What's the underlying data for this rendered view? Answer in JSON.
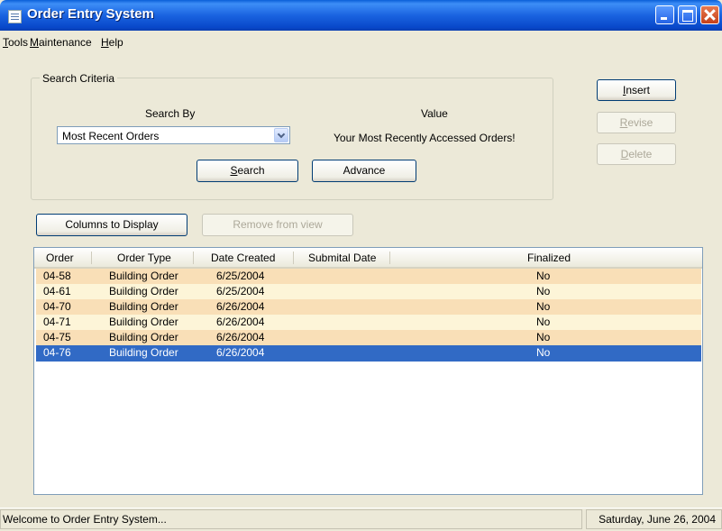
{
  "window": {
    "title": "Order Entry System"
  },
  "menu": {
    "items": [
      {
        "hotkey": "T",
        "rest": "ools"
      },
      {
        "hotkey": "M",
        "rest": "aintenance"
      },
      {
        "hotkey": "H",
        "rest": "elp"
      }
    ]
  },
  "search": {
    "group_label": "Search Criteria",
    "search_by_label": "Search By",
    "search_by_value": "Most Recent Orders",
    "value_label": "Value",
    "value_text": "Your Most Recently Accessed Orders!",
    "search_button": {
      "hotkey": "S",
      "rest": "earch"
    },
    "advance_button": "Advance"
  },
  "actions": {
    "insert": {
      "hotkey": "I",
      "rest": "nsert"
    },
    "revise": {
      "hotkey": "R",
      "rest": "evise"
    },
    "delete": {
      "hotkey": "D",
      "rest": "elete"
    }
  },
  "list_controls": {
    "columns_to_display": "Columns to Display",
    "remove_from_view": "Remove from view"
  },
  "table": {
    "columns": [
      "Order",
      "Order Type",
      "Date Created",
      "Submital Date",
      "Finalized"
    ],
    "rows": [
      {
        "order": "04-58",
        "order_type": "Building Order",
        "date_created": "6/25/2004",
        "submital_date": "",
        "finalized": "No"
      },
      {
        "order": "04-61",
        "order_type": "Building Order",
        "date_created": "6/25/2004",
        "submital_date": "",
        "finalized": "No"
      },
      {
        "order": "04-70",
        "order_type": "Building Order",
        "date_created": "6/26/2004",
        "submital_date": "",
        "finalized": "No"
      },
      {
        "order": "04-71",
        "order_type": "Building Order",
        "date_created": "6/26/2004",
        "submital_date": "",
        "finalized": "No"
      },
      {
        "order": "04-75",
        "order_type": "Building Order",
        "date_created": "6/26/2004",
        "submital_date": "",
        "finalized": "No"
      },
      {
        "order": "04-76",
        "order_type": "Building Order",
        "date_created": "6/26/2004",
        "submital_date": "",
        "finalized": "No"
      }
    ],
    "selected_row": 5
  },
  "colors": {
    "row_odd": "#f9dfb7",
    "row_even": "#fdf5d8",
    "row_selected": "#316ac5"
  },
  "status": {
    "message": "Welcome to Order Entry System...",
    "date": "Saturday, June 26, 2004"
  }
}
